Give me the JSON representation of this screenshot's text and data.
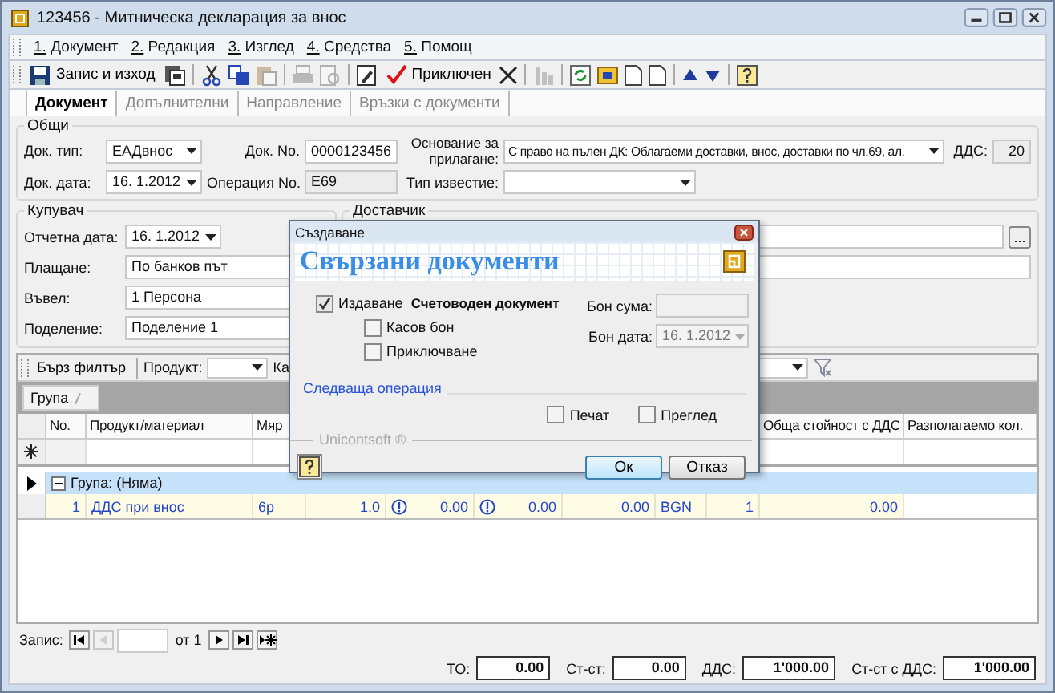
{
  "window": {
    "title": "123456 - Митническа декларация за внос"
  },
  "menu": [
    {
      "label": "1. Документ"
    },
    {
      "label": "2. Редакция"
    },
    {
      "label": "3. Изглед"
    },
    {
      "label": "4. Средства"
    },
    {
      "label": "5. Помощ"
    }
  ],
  "toolbar": [
    {
      "kind": "button",
      "label": "Запис и изход",
      "disabled": false
    },
    {
      "kind": "icon",
      "disabled": false
    },
    {
      "kind": "separator"
    },
    {
      "kind": "icon",
      "disabled": false
    },
    {
      "kind": "icon",
      "disabled": false
    },
    {
      "kind": "icon",
      "disabled": true
    },
    {
      "kind": "separator"
    },
    {
      "kind": "icon",
      "disabled": true
    },
    {
      "kind": "icon",
      "disabled": true
    },
    {
      "kind": "separator"
    },
    {
      "kind": "icon",
      "disabled": false
    },
    {
      "kind": "button",
      "label": "Приключен",
      "disabled": false
    },
    {
      "kind": "icon",
      "disabled": false
    },
    {
      "kind": "separator"
    },
    {
      "kind": "icon",
      "disabled": true
    },
    {
      "kind": "separator"
    },
    {
      "kind": "icon",
      "disabled": false
    },
    {
      "kind": "icon",
      "disabled": false
    },
    {
      "kind": "icon",
      "disabled": false
    },
    {
      "kind": "icon",
      "disabled": false
    },
    {
      "kind": "separator"
    },
    {
      "kind": "icon",
      "disabled": false
    },
    {
      "kind": "icon",
      "disabled": false
    },
    {
      "kind": "separator"
    },
    {
      "kind": "icon",
      "disabled": false
    }
  ],
  "tabs": [
    {
      "label": "Документ",
      "selected": true
    },
    {
      "label": "Допълнителни",
      "selected": false
    },
    {
      "label": "Направление",
      "selected": false
    },
    {
      "label": "Връзки с документи",
      "selected": false
    }
  ],
  "general": {
    "title": "Общи",
    "doc_type": {
      "label": "Док. тип:",
      "value": "ЕАДвнос"
    },
    "doc_no": {
      "label": "Док. No.",
      "value": "0000123456"
    },
    "basis": {
      "label": "Основание за прилагане:",
      "value": "С право на пълен ДК: Облагаеми доставки, внос, доставки по чл.69, ал."
    },
    "vat": {
      "label": "ДДС:",
      "value": "20"
    },
    "doc_date": {
      "label": "Док. дата:",
      "value": "16. 1.2012"
    },
    "op_no": {
      "label": "Операция No.",
      "value": "E69"
    },
    "notice_type": {
      "label": "Тип известие:"
    }
  },
  "buyer": {
    "title": "Купувач",
    "report_date": {
      "label": "Отчетна дата:",
      "value": "16. 1.2012"
    },
    "payment": {
      "label": "Плащане:",
      "value": "По банков път"
    },
    "entered_by": {
      "label": "Въвел:",
      "value": "1 Персона"
    },
    "division": {
      "label": "Поделение:",
      "value": "Поделение 1"
    }
  },
  "supplier": {
    "title": "Доставчик",
    "browse_button": "..."
  },
  "grid": {
    "quick_filter": "Бърз филтър",
    "product_filter": "Продукт:",
    "category_filter": "Ка",
    "group_chip": "Група",
    "columns": [
      {
        "label": "No."
      },
      {
        "label": "Продукт/материал"
      },
      {
        "label": "Мяр"
      },
      {},
      {},
      {},
      {},
      {},
      {},
      {
        "label": "Обща стойност с ДДС"
      },
      {
        "label": "Разполагаемо кол."
      }
    ],
    "group_row": {
      "label": "Група: (Няма)",
      "expanded": true
    },
    "rows": [
      {
        "cells": [
          "1",
          "ДДС при внос",
          "6р",
          "1.0",
          "0.00",
          "0.00",
          "0.00",
          "BGN",
          "1",
          "0.00"
        ]
      }
    ]
  },
  "navigator": {
    "label": "Запис:",
    "of": "от 1"
  },
  "totals": [
    {
      "label": "ТО:",
      "value": "0.00"
    },
    {
      "label": "Ст-ст:",
      "value": "0.00"
    },
    {
      "label": "ДДС:",
      "value": "1'000.00"
    },
    {
      "label": "Ст-ст с ДДС:",
      "value": "1'000.00"
    }
  ],
  "dialog": {
    "title": "Създаване",
    "heading": "Свързани документи",
    "issue": {
      "label": "Издаване",
      "checked": true,
      "document": "Счетоводен документ"
    },
    "options": [
      {
        "label": "Касов бон",
        "checked": false
      },
      {
        "label": "Приключване",
        "checked": false
      }
    ],
    "receipt_amount": {
      "label": "Бон сума:"
    },
    "receipt_date": {
      "label": "Бон дата:",
      "value": "16. 1.2012"
    },
    "next_operation": "Следваща операция",
    "outputs": [
      {
        "label": "Печат",
        "checked": false
      },
      {
        "label": "Преглед",
        "checked": false
      }
    ],
    "brand": "Unicontsoft ®",
    "ok": "Ок",
    "cancel": "Отказ"
  }
}
